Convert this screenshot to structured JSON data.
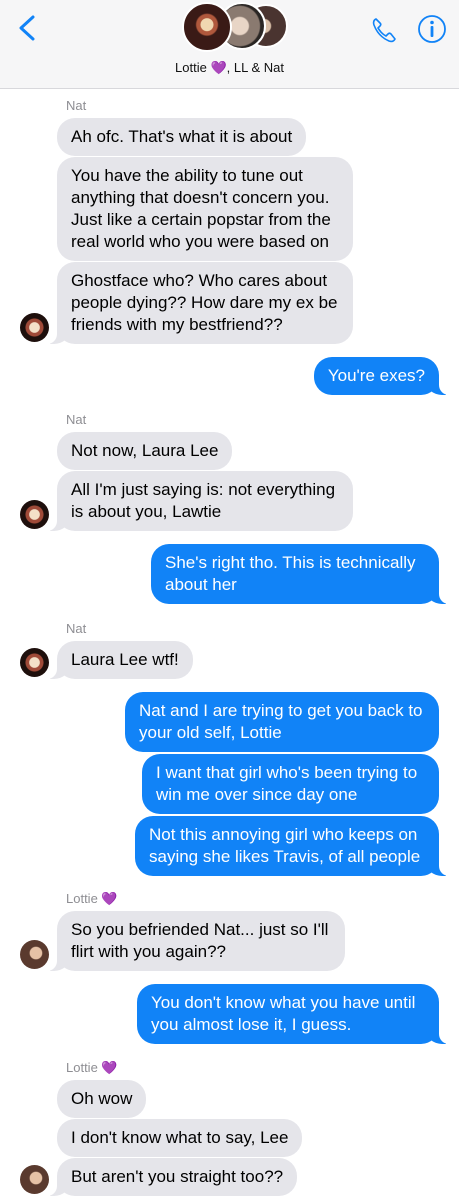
{
  "header": {
    "title": "Lottie 💜, LL & Nat"
  },
  "messages": [
    {
      "type": "sender",
      "name": "Nat"
    },
    {
      "type": "in",
      "text": "Ah ofc. That's what it is about"
    },
    {
      "type": "in",
      "text": "You have the ability to tune out anything that doesn't concern you. Just like a certain popstar from the real world who you were based on"
    },
    {
      "type": "in",
      "text": "Ghostface who? Who cares about people dying?? How dare my ex be friends with my bestfriend??"
    },
    {
      "type": "out",
      "text": "You're exes?"
    },
    {
      "type": "sender",
      "name": "Nat"
    },
    {
      "type": "in",
      "text": "Not now, Laura Lee"
    },
    {
      "type": "in",
      "text": "All I'm just saying is: not everything is about you, Lawtie"
    },
    {
      "type": "out",
      "text": "She's right tho. This is technically about her"
    },
    {
      "type": "sender",
      "name": "Nat"
    },
    {
      "type": "in",
      "text": "Laura Lee wtf!"
    },
    {
      "type": "out",
      "text": "Nat and I are trying to get you back to your old self, Lottie"
    },
    {
      "type": "out",
      "text": "I want that girl who's been trying to win me over since day one"
    },
    {
      "type": "out",
      "text": "Not this annoying girl who keeps on saying she likes Travis, of all people"
    },
    {
      "type": "sender",
      "name": "Lottie 💜"
    },
    {
      "type": "in",
      "text": "So you befriended Nat... just so I'll flirt with you again??"
    },
    {
      "type": "out",
      "text": "You don't know what you have until you almost lose it, I guess."
    },
    {
      "type": "sender",
      "name": "Lottie 💜"
    },
    {
      "type": "in",
      "text": "Oh wow"
    },
    {
      "type": "in",
      "text": "I don't know what to say, Lee"
    },
    {
      "type": "in",
      "text": "But aren't you straight too??"
    }
  ]
}
